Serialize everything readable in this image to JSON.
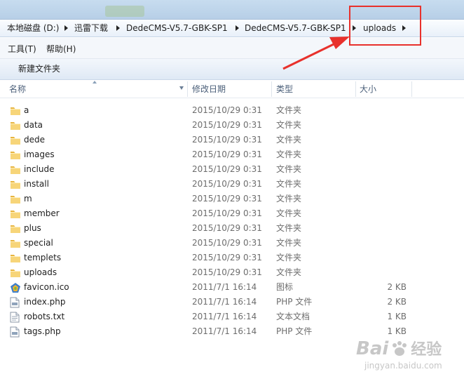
{
  "breadcrumb": {
    "items": [
      "本地磁盘 (D:)",
      "迅雷下载",
      "DedeCMS-V5.7-GBK-SP1",
      "DedeCMS-V5.7-GBK-SP1",
      "uploads"
    ]
  },
  "menu": {
    "tools": "工具(T)",
    "help": "帮助(H)"
  },
  "toolbar": {
    "new_folder": "新建文件夹"
  },
  "columns": {
    "name": "名称",
    "date": "修改日期",
    "type": "类型",
    "size": "大小"
  },
  "files": [
    {
      "name": "a",
      "date": "2015/10/29 0:31",
      "type": "文件夹",
      "size": "",
      "icon": "folder-icon"
    },
    {
      "name": "data",
      "date": "2015/10/29 0:31",
      "type": "文件夹",
      "size": "",
      "icon": "folder-icon"
    },
    {
      "name": "dede",
      "date": "2015/10/29 0:31",
      "type": "文件夹",
      "size": "",
      "icon": "folder-icon"
    },
    {
      "name": "images",
      "date": "2015/10/29 0:31",
      "type": "文件夹",
      "size": "",
      "icon": "folder-icon"
    },
    {
      "name": "include",
      "date": "2015/10/29 0:31",
      "type": "文件夹",
      "size": "",
      "icon": "folder-icon"
    },
    {
      "name": "install",
      "date": "2015/10/29 0:31",
      "type": "文件夹",
      "size": "",
      "icon": "folder-icon"
    },
    {
      "name": "m",
      "date": "2015/10/29 0:31",
      "type": "文件夹",
      "size": "",
      "icon": "folder-icon"
    },
    {
      "name": "member",
      "date": "2015/10/29 0:31",
      "type": "文件夹",
      "size": "",
      "icon": "folder-icon"
    },
    {
      "name": "plus",
      "date": "2015/10/29 0:31",
      "type": "文件夹",
      "size": "",
      "icon": "folder-icon"
    },
    {
      "name": "special",
      "date": "2015/10/29 0:31",
      "type": "文件夹",
      "size": "",
      "icon": "folder-icon"
    },
    {
      "name": "templets",
      "date": "2015/10/29 0:31",
      "type": "文件夹",
      "size": "",
      "icon": "folder-icon"
    },
    {
      "name": "uploads",
      "date": "2015/10/29 0:31",
      "type": "文件夹",
      "size": "",
      "icon": "folder-icon"
    },
    {
      "name": "favicon.ico",
      "date": "2011/7/1 16:14",
      "type": "图标",
      "size": "2 KB",
      "icon": "ico-file-icon"
    },
    {
      "name": "index.php",
      "date": "2011/7/1 16:14",
      "type": "PHP 文件",
      "size": "2 KB",
      "icon": "php-file-icon"
    },
    {
      "name": "robots.txt",
      "date": "2011/7/1 16:14",
      "type": "文本文档",
      "size": "1 KB",
      "icon": "text-file-icon"
    },
    {
      "name": "tags.php",
      "date": "2011/7/1 16:14",
      "type": "PHP 文件",
      "size": "1 KB",
      "icon": "php-file-icon"
    }
  ],
  "watermark": {
    "brand": "Bai",
    "brand2": "经验",
    "url": "jingyan.baidu.com"
  },
  "colors": {
    "highlight_box": "#e8312c",
    "folder": "#f2c14e",
    "accent": "#c5d9ef"
  }
}
